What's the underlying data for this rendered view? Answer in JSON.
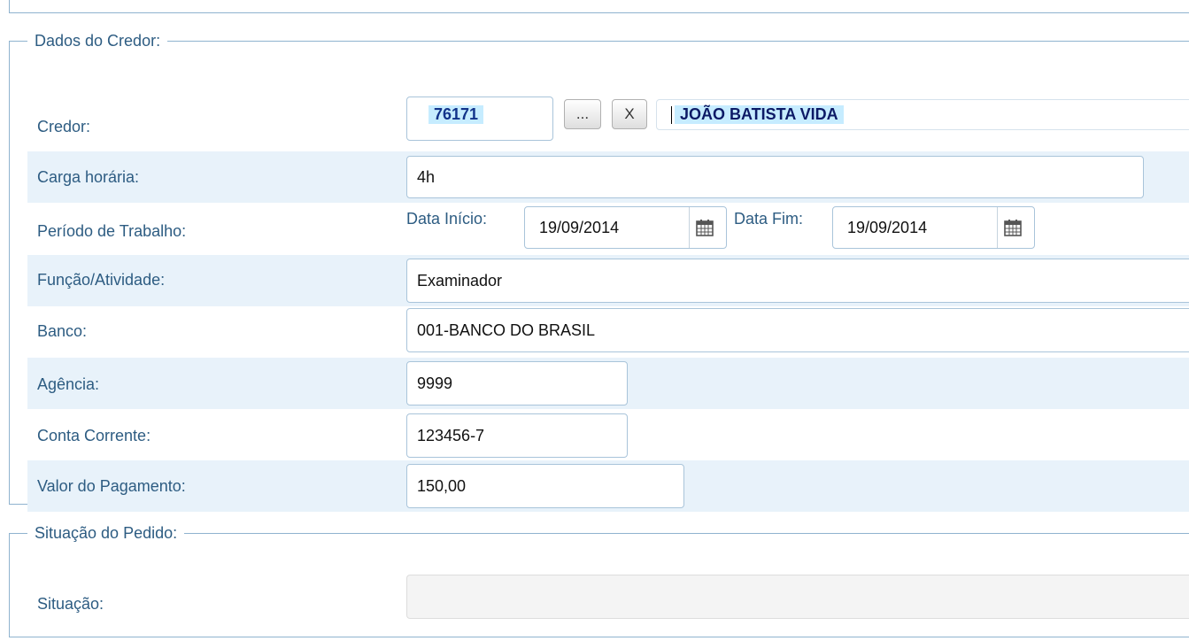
{
  "credor_section": {
    "legend": "Dados do Credor:",
    "credor": {
      "label": "Credor:",
      "code": "76171",
      "lookup_button": "...",
      "clear_button": "X",
      "name": "JOÃO BATISTA VIDA"
    },
    "carga_horaria": {
      "label": "Carga horária:",
      "value": "4h"
    },
    "periodo": {
      "label": "Período de Trabalho:",
      "inicio_label": "Data Início:",
      "inicio_value": "19/09/2014",
      "fim_label": "Data Fim:",
      "fim_value": "19/09/2014"
    },
    "funcao": {
      "label": "Função/Atividade:",
      "value": "Examinador"
    },
    "banco": {
      "label": "Banco:",
      "value": "001-BANCO DO BRASIL"
    },
    "agencia": {
      "label": "Agência:",
      "value": "9999"
    },
    "conta": {
      "label": "Conta Corrente:",
      "value": "123456-7"
    },
    "valor": {
      "label": "Valor do Pagamento:",
      "value": "150,00"
    }
  },
  "situacao_section": {
    "legend": "Situação do Pedido:",
    "situacao": {
      "label": "Situação:",
      "value": ""
    }
  },
  "colors": {
    "label": "#2d5c82",
    "row_alt": "#e8f2fa",
    "border": "#8fb3cf",
    "highlight": "#c6ecff"
  }
}
